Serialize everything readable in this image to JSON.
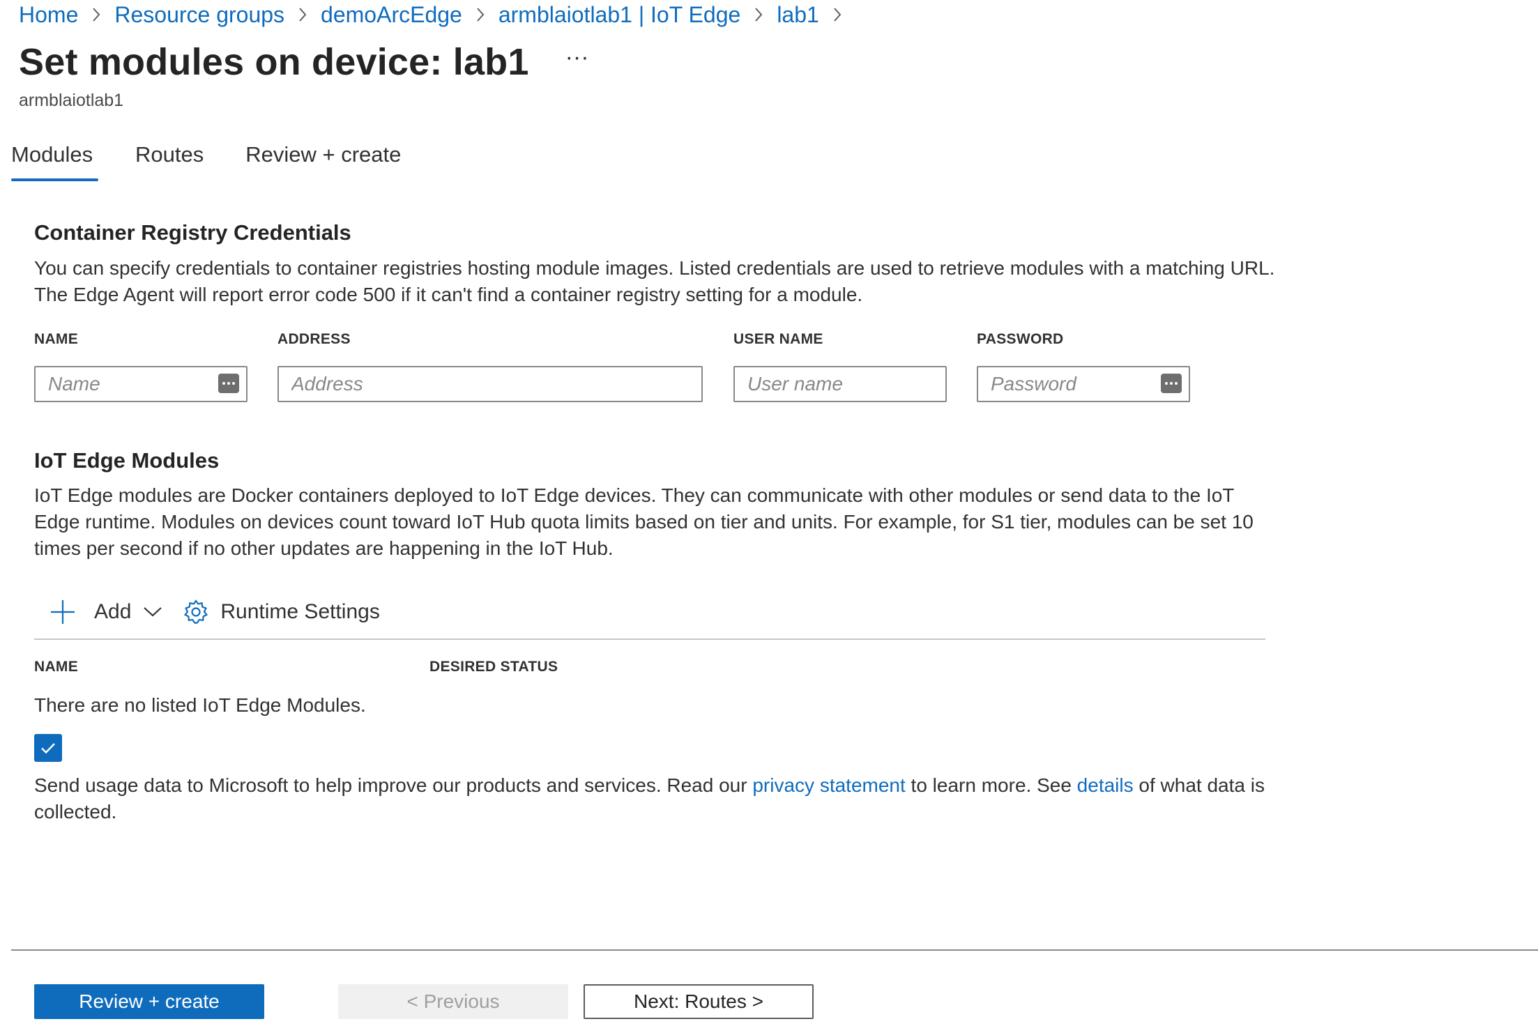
{
  "breadcrumb": {
    "items": [
      "Home",
      "Resource groups",
      "demoArcEdge",
      "armblaiotlab1 | IoT Edge",
      "lab1"
    ]
  },
  "header": {
    "title": "Set modules on device: lab1",
    "more": "···",
    "subtitle": "armblaiotlab1"
  },
  "tabs": [
    {
      "label": "Modules",
      "active": true
    },
    {
      "label": "Routes",
      "active": false
    },
    {
      "label": "Review + create",
      "active": false
    }
  ],
  "registry": {
    "title": "Container Registry Credentials",
    "description": "You can specify credentials to container registries hosting module images. Listed credentials are used to retrieve modules with a matching URL. The Edge Agent will report error code 500 if it can't find a container registry setting for a module.",
    "fields": {
      "name": {
        "label": "NAME",
        "placeholder": "Name",
        "value": ""
      },
      "address": {
        "label": "ADDRESS",
        "placeholder": "Address",
        "value": ""
      },
      "username": {
        "label": "USER NAME",
        "placeholder": "User name",
        "value": ""
      },
      "password": {
        "label": "PASSWORD",
        "placeholder": "Password",
        "value": ""
      }
    }
  },
  "modules": {
    "title": "IoT Edge Modules",
    "description": "IoT Edge modules are Docker containers deployed to IoT Edge devices. They can communicate with other modules or send data to the IoT Edge runtime. Modules on devices count toward IoT Hub quota limits based on tier and units. For example, for S1 tier, modules can be set 10 times per second if no other updates are happening in the IoT Hub.",
    "toolbar": {
      "add": "Add",
      "runtime": "Runtime Settings"
    },
    "columns": [
      "NAME",
      "DESIRED STATUS"
    ],
    "empty": "There are no listed IoT Edge Modules."
  },
  "consent": {
    "checked": true,
    "text1": "Send usage data to Microsoft to help improve our products and services. Read our ",
    "link1": "privacy statement",
    "text2": " to learn more. See ",
    "link2": "details",
    "text3": " of what data is collected."
  },
  "footer": {
    "review": "Review + create",
    "previous": "< Previous",
    "next": "Next: Routes >"
  },
  "colors": {
    "accent": "#0f6cbd",
    "text": "#323130",
    "border": "#8a8886"
  },
  "icons": [
    "chevron-right-icon",
    "more-icon",
    "password-key-icon",
    "plus-icon",
    "chevron-down-icon",
    "gear-icon",
    "checkmark-icon"
  ]
}
